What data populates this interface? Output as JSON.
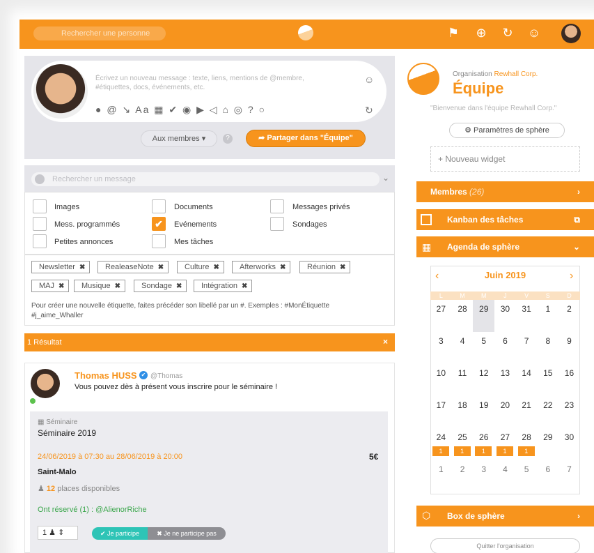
{
  "topbar": {
    "search_placeholder": "Rechercher une personne",
    "icons": [
      "flag-icon",
      "add-team-icon",
      "add-sphere-icon",
      "add-contact-icon"
    ]
  },
  "composer": {
    "placeholder": "Écrivez un nouveau message : texte, liens, mentions de @membre, #étiquettes, docs, événements, etc.",
    "tools": "● @ ↘ Aa ▦ ✔ ◉ ▶ ◁ ⌂ ◎ ? ○",
    "audience_label": "Aux membres ▾",
    "share_label": "➦  Partager dans \"Équipe\""
  },
  "message_search": {
    "placeholder": "Rechercher un message"
  },
  "filters": [
    {
      "label": "Images",
      "checked": false
    },
    {
      "label": "Documents",
      "checked": false
    },
    {
      "label": "Messages privés",
      "checked": false
    },
    {
      "label": "Mess. programmés",
      "checked": false
    },
    {
      "label": "Evénements",
      "checked": true
    },
    {
      "label": "Sondages",
      "checked": false
    },
    {
      "label": "Petites annonces",
      "checked": false
    },
    {
      "label": "Mes tâches",
      "checked": false
    }
  ],
  "tags": [
    "Newsletter",
    "RealeaseNote",
    "Culture",
    "Afterworks",
    "Réunion",
    "MAJ",
    "Musique",
    "Sondage",
    "Intégration"
  ],
  "tag_help": "Pour créer une nouvelle étiquette, faites précéder son libellé par un #. Exemples : #MonÉtiquette #j_aime_Whaller",
  "results": {
    "label": "1 Résultat",
    "close": "×"
  },
  "post": {
    "author": "Thomas HUSS",
    "handle": "@Thomas",
    "text": "Vous pouvez dès à présent vous inscrire pour le séminaire !",
    "event": {
      "category": "Séminaire",
      "title": "Séminaire 2019",
      "dates": "24/06/2019 à 07:30 au 28/06/2019 à 20:00",
      "price": "5€",
      "place": "Saint-Malo",
      "spots_count": "12",
      "spots_label": " places disponibles",
      "reserved": "Ont réservé (1) : @AlienorRiche",
      "quantity": "1   ♟ ⇕",
      "yes_label": "✔ Je participe",
      "no_label": "✖ Je ne participe pas"
    }
  },
  "sidebar": {
    "org_prefix": "Organisation ",
    "org_name": "Rewhall Corp.",
    "sphere_title": "Équipe",
    "welcome": "\"Bienvenue dans l'équipe Rewhall Corp.\"",
    "params_label": "⚙ Paramètres de sphère",
    "new_widget_label": "+  Nouveau widget",
    "members_label": "Membres",
    "members_count": "(26)",
    "kanban_label": "Kanban des tâches",
    "agenda_label": "Agenda de sphère",
    "box_label": "Box de sphère",
    "quit_label": "Quitter l'organisation"
  },
  "calendar": {
    "month": "Juin 2019",
    "dow": [
      "L",
      "M",
      "M",
      "J",
      "V",
      "S",
      "D"
    ],
    "weeks": [
      [
        "27",
        "28",
        "29",
        "30",
        "31",
        "1",
        "2"
      ],
      [
        "3",
        "4",
        "5",
        "6",
        "7",
        "8",
        "9"
      ],
      [
        "10",
        "11",
        "12",
        "13",
        "14",
        "15",
        "16"
      ],
      [
        "17",
        "18",
        "19",
        "20",
        "21",
        "22",
        "23"
      ],
      [
        "24",
        "25",
        "26",
        "27",
        "28",
        "29",
        "30"
      ],
      [
        "1",
        "2",
        "3",
        "4",
        "5",
        "6",
        "7"
      ]
    ],
    "event_marks": [
      "1",
      "1",
      "1",
      "1",
      "1"
    ]
  },
  "colors": {
    "accent": "#f7941d",
    "success": "#2ec4b6",
    "muted": "#8e8e93"
  }
}
